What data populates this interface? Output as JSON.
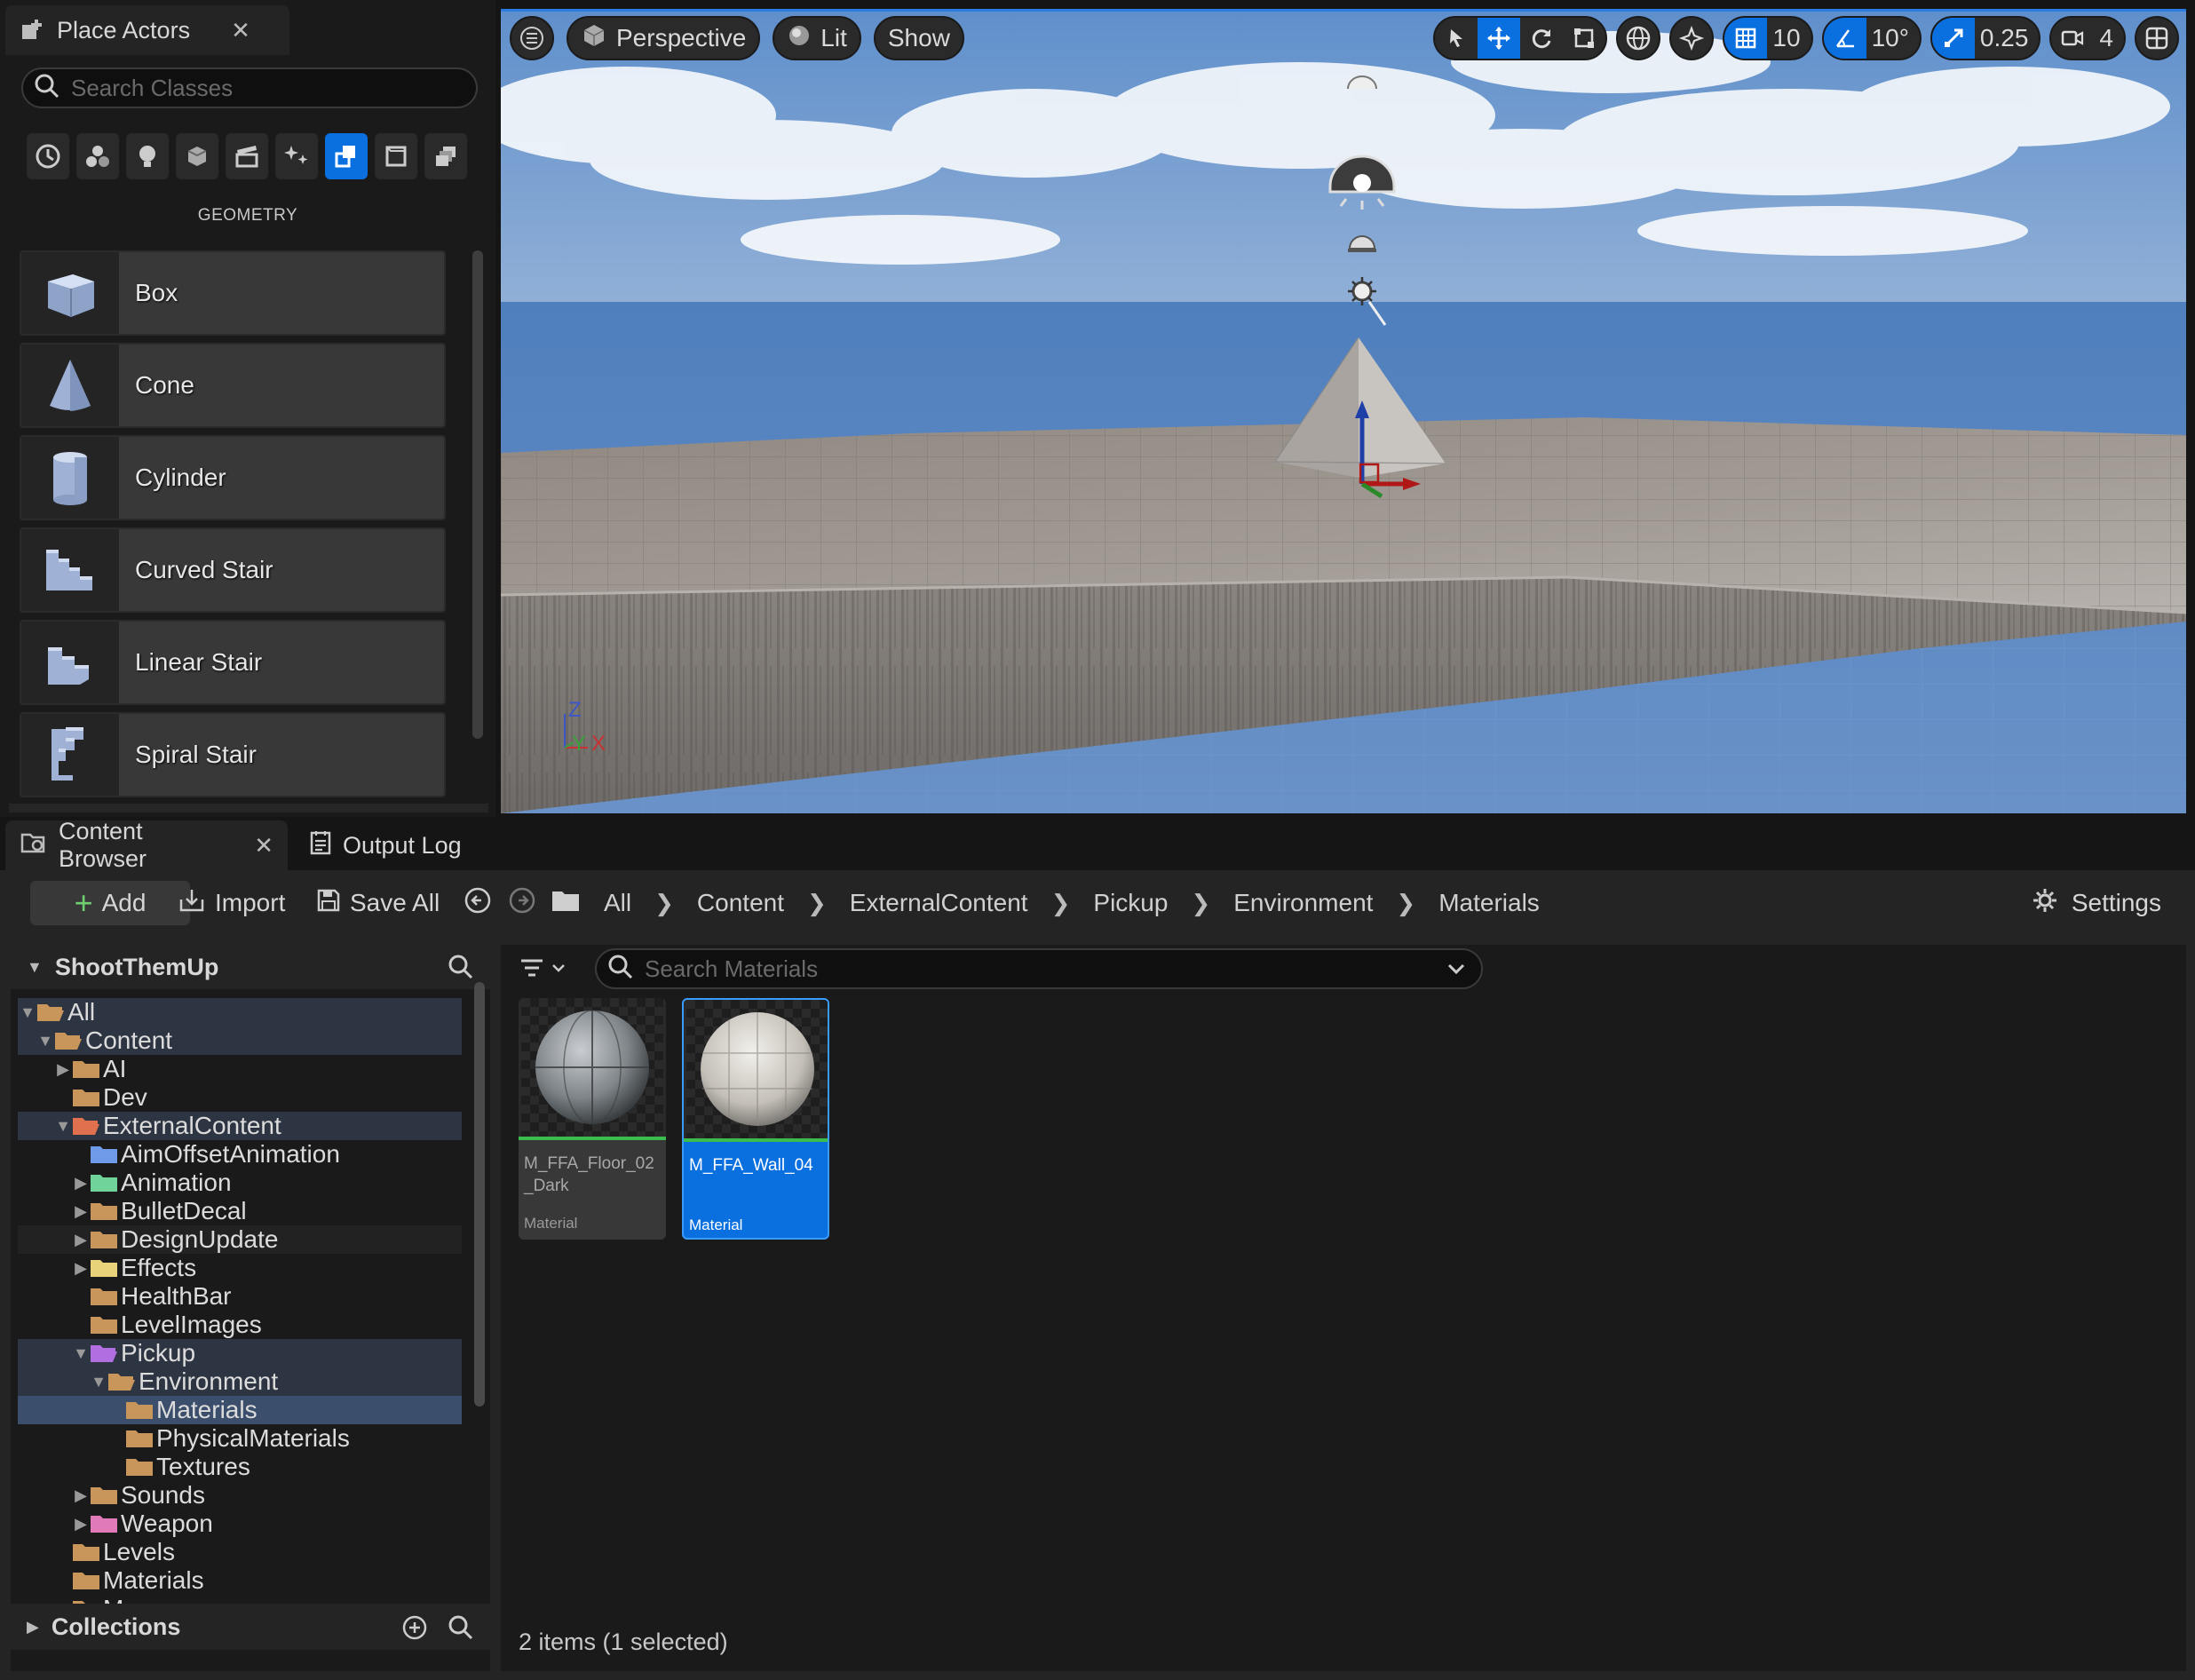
{
  "place_actors": {
    "tab_title": "Place Actors",
    "search_placeholder": "Search Classes",
    "category_label": "GEOMETRY",
    "categories": [
      "recent-icon",
      "basic-icon",
      "lights-icon",
      "shapes-icon",
      "cinematic-icon",
      "visual-effects-icon",
      "geometry-icon",
      "volumes-icon",
      "all-classes-icon"
    ],
    "active_category": "geometry-icon",
    "items": [
      {
        "label": "Box",
        "icon": "box-icon"
      },
      {
        "label": "Cone",
        "icon": "cone-icon"
      },
      {
        "label": "Cylinder",
        "icon": "cylinder-icon"
      },
      {
        "label": "Curved Stair",
        "icon": "curved-stair-icon"
      },
      {
        "label": "Linear Stair",
        "icon": "linear-stair-icon"
      },
      {
        "label": "Spiral Stair",
        "icon": "spiral-stair-icon"
      }
    ]
  },
  "viewport": {
    "view_mode": "Perspective",
    "lighting_mode": "Lit",
    "show_label": "Show",
    "grid_snap": "10",
    "rotation_snap": "10°",
    "scale_snap": "0.25",
    "camera_speed": "4",
    "axis": {
      "z": "Z",
      "y": "Y",
      "x": "X"
    }
  },
  "bottom_tabs": {
    "content_browser": "Content Browser",
    "output_log": "Output Log"
  },
  "content_browser": {
    "add_label": "Add",
    "import_label": "Import",
    "save_all_label": "Save All",
    "settings_label": "Settings",
    "breadcrumb": [
      "All",
      "Content",
      "ExternalContent",
      "Pickup",
      "Environment",
      "Materials"
    ],
    "project_name": "ShootThemUp",
    "collections_label": "Collections",
    "search_placeholder": "Search Materials",
    "status": "2 items (1 selected)",
    "tree": [
      {
        "label": "All",
        "depth": 0,
        "arrow": "open",
        "color": "#c8955a",
        "state": "hl"
      },
      {
        "label": "Content",
        "depth": 1,
        "arrow": "open",
        "color": "#c8955a",
        "state": "hl"
      },
      {
        "label": "AI",
        "depth": 2,
        "arrow": "closed",
        "color": "#c8955a",
        "state": ""
      },
      {
        "label": "Dev",
        "depth": 2,
        "arrow": "",
        "color": "#c8955a",
        "state": ""
      },
      {
        "label": "ExternalContent",
        "depth": 2,
        "arrow": "open",
        "color": "#e0704e",
        "state": "hl"
      },
      {
        "label": "AimOffsetAnimation",
        "depth": 3,
        "arrow": "",
        "color": "#6e9ae8",
        "state": ""
      },
      {
        "label": "Animation",
        "depth": 3,
        "arrow": "closed",
        "color": "#6fd39a",
        "state": ""
      },
      {
        "label": "BulletDecal",
        "depth": 3,
        "arrow": "closed",
        "color": "#c8955a",
        "state": ""
      },
      {
        "label": "DesignUpdate",
        "depth": 3,
        "arrow": "closed",
        "color": "#c8955a",
        "state": "dim"
      },
      {
        "label": "Effects",
        "depth": 3,
        "arrow": "closed",
        "color": "#e8d27a",
        "state": ""
      },
      {
        "label": "HealthBar",
        "depth": 3,
        "arrow": "",
        "color": "#c8955a",
        "state": ""
      },
      {
        "label": "LevelImages",
        "depth": 3,
        "arrow": "",
        "color": "#c8955a",
        "state": ""
      },
      {
        "label": "Pickup",
        "depth": 3,
        "arrow": "open",
        "color": "#b06ee0",
        "state": "hl"
      },
      {
        "label": "Environment",
        "depth": 4,
        "arrow": "open",
        "color": "#c8955a",
        "state": "hl"
      },
      {
        "label": "Materials",
        "depth": 5,
        "arrow": "",
        "color": "#c8955a",
        "state": "sel"
      },
      {
        "label": "PhysicalMaterials",
        "depth": 5,
        "arrow": "",
        "color": "#c8955a",
        "state": ""
      },
      {
        "label": "Textures",
        "depth": 5,
        "arrow": "",
        "color": "#c8955a",
        "state": ""
      },
      {
        "label": "Sounds",
        "depth": 3,
        "arrow": "closed",
        "color": "#c8955a",
        "state": ""
      },
      {
        "label": "Weapon",
        "depth": 3,
        "arrow": "closed",
        "color": "#e07ab8",
        "state": ""
      },
      {
        "label": "Levels",
        "depth": 2,
        "arrow": "",
        "color": "#c8955a",
        "state": ""
      },
      {
        "label": "Materials",
        "depth": 2,
        "arrow": "",
        "color": "#c8955a",
        "state": ""
      },
      {
        "label": "Menu",
        "depth": 2,
        "arrow": "closed",
        "color": "#c8955a",
        "state": ""
      }
    ],
    "assets": [
      {
        "name": "M_FFA_Floor_02_Dark",
        "type": "Material",
        "selected": false
      },
      {
        "name": "M_FFA_Wall_04",
        "type": "Material",
        "selected": true
      }
    ]
  },
  "colors": {
    "accent": "#0a70e0",
    "panel_bg": "#1a1a1a",
    "toolbar_bg": "#242424",
    "asset_underline": "#3bbd4e"
  }
}
